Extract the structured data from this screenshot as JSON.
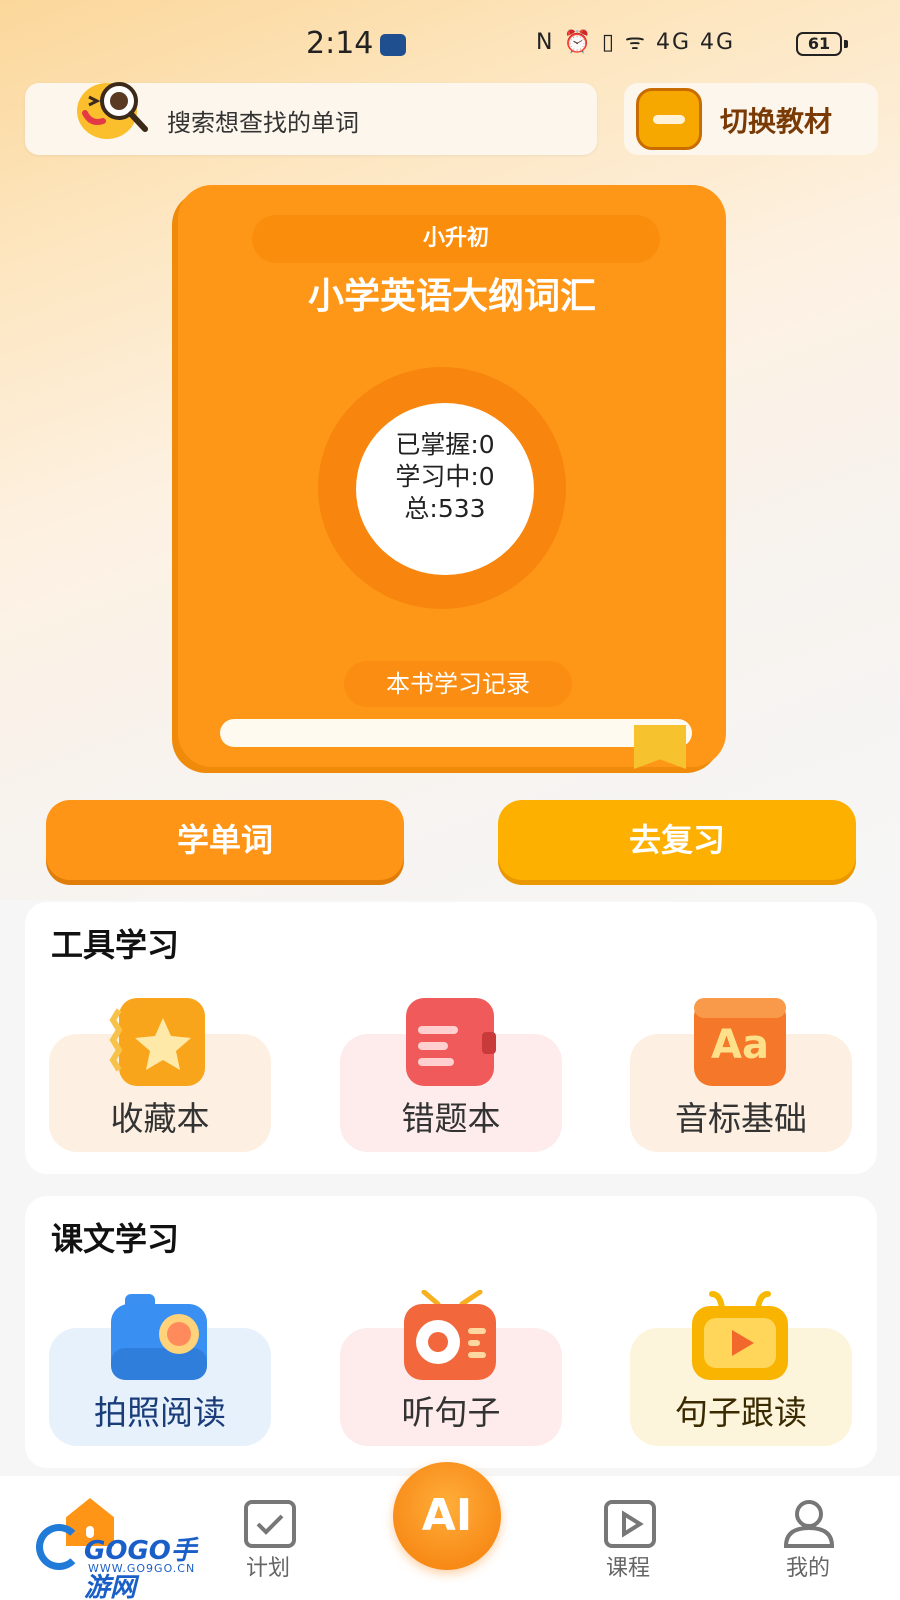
{
  "status_bar": {
    "time": "2:14",
    "status_icons": "N ⏰ ▯ ᯤ 4G 4G",
    "battery": "61"
  },
  "search": {
    "placeholder": "搜索想查找的单词"
  },
  "switch_textbook": {
    "label": "切换教材"
  },
  "book": {
    "tag": "小升初",
    "title": "小学英语大纲词汇",
    "mastered": "已掌握:0",
    "learning": "学习中:0",
    "total": "总:533",
    "record_label": "本书学习记录"
  },
  "actions": {
    "learn": "学单词",
    "review": "去复习"
  },
  "tools": {
    "title": "工具学习",
    "items": [
      {
        "label": "收藏本",
        "icon": "star-book-icon"
      },
      {
        "label": "错题本",
        "icon": "notebook-icon"
      },
      {
        "label": "音标基础",
        "icon": "aa-icon"
      }
    ]
  },
  "text_study": {
    "title": "课文学习",
    "items": [
      {
        "label": "拍照阅读",
        "icon": "camera-icon"
      },
      {
        "label": "听句子",
        "icon": "radio-icon"
      },
      {
        "label": "句子跟读",
        "icon": "tv-play-icon"
      }
    ]
  },
  "nav": {
    "items": [
      {
        "label": "",
        "icon": "home-icon"
      },
      {
        "label": "计划",
        "icon": "plan-icon"
      },
      {
        "label": "AI",
        "icon": "ai-icon"
      },
      {
        "label": "课程",
        "icon": "play-icon"
      },
      {
        "label": "我的",
        "icon": "user-icon"
      }
    ]
  },
  "watermark": {
    "brand": "GOGO手游网",
    "url": "WWW.GO9GO.CN"
  },
  "colors": {
    "accent_orange": "#ff9516",
    "accent_yellow": "#fdb000",
    "book_orange": "#fe9717"
  }
}
